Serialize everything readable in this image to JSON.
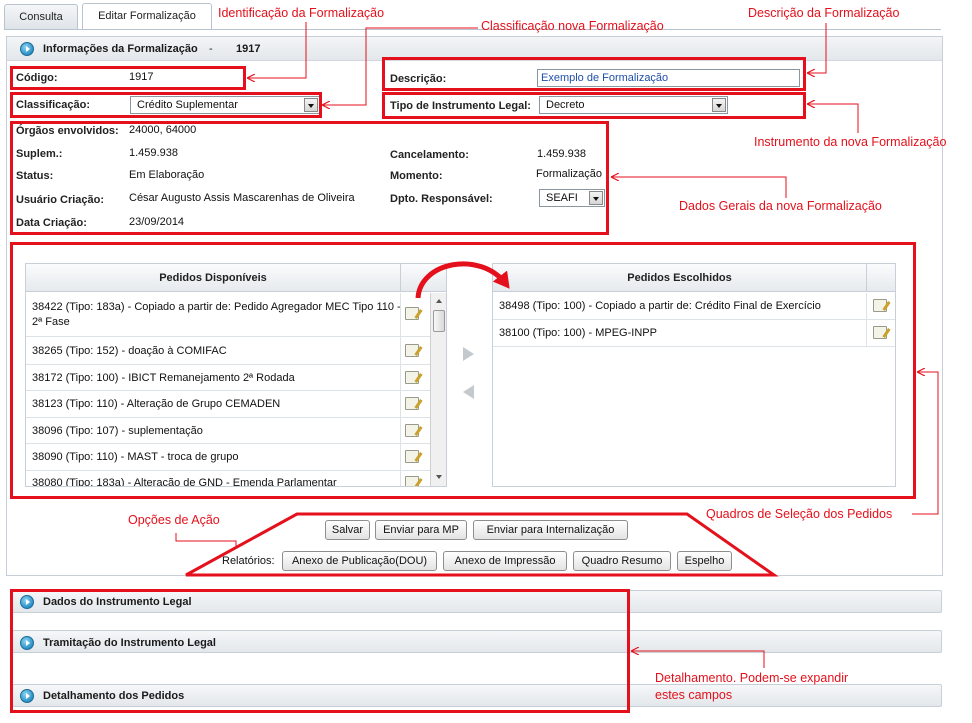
{
  "tabs": [
    {
      "label": "Consulta"
    },
    {
      "label": "Editar Formalização"
    }
  ],
  "header": {
    "title": "Informações da Formalização",
    "separator": "-",
    "id": "1917"
  },
  "form": {
    "codigo_label": "Código:",
    "codigo_value": "1917",
    "descricao_label": "Descrição:",
    "descricao_value": "Exemplo de Formalização",
    "classificacao_label": "Classificação:",
    "classificacao_value": "Crédito Suplementar",
    "tipo_label": "Tipo de Instrumento Legal:",
    "tipo_value": "Decreto",
    "orgaos_label": "Órgãos envolvidos:",
    "orgaos_value": "24000, 64000",
    "suplem_label": "Suplem.:",
    "suplem_value": "1.459.938",
    "cancelamento_label": "Cancelamento:",
    "cancelamento_value": "1.459.938",
    "status_label": "Status:",
    "status_value": "Em Elaboração",
    "momento_label": "Momento:",
    "momento_value": "Formalização",
    "usuario_label": "Usuário Criação:",
    "usuario_value": "César Augusto Assis Mascarenhas de Oliveira",
    "dpto_label": "Dpto. Responsável:",
    "dpto_value": "SEAFI",
    "data_label": "Data Criação:",
    "data_value": "23/09/2014"
  },
  "pedidos_disponiveis": {
    "header": "Pedidos Disponíveis",
    "items": [
      "38422 (Tipo: 183a) - Copiado a partir de: Pedido Agregador MEC Tipo 110 -",
      "2ª Fase",
      "38265 (Tipo: 152) - doação à COMIFAC",
      "38172 (Tipo: 100) - IBICT Remanejamento 2ª Rodada",
      "38123 (Tipo: 110) - Alteração de Grupo CEMADEN",
      "38096 (Tipo: 107) - suplementação",
      "38090 (Tipo: 110) - MAST - troca de grupo",
      "38080 (Tipo: 183a) - Alteração de GND - Emenda Parlamentar"
    ]
  },
  "pedidos_escolhidos": {
    "header": "Pedidos Escolhidos",
    "items": [
      "38498 (Tipo: 100) - Copiado a partir de: Crédito Final de Exercício",
      "38100 (Tipo: 100) - MPEG-INPP"
    ]
  },
  "actions": {
    "salvar": "Salvar",
    "enviar_mp": "Enviar para MP",
    "enviar_internalizacao": "Enviar para Internalização",
    "relatorios_label": "Relatórios:",
    "anexo_publicacao": "Anexo de Publicação(DOU)",
    "anexo_impressao": "Anexo de Impressão",
    "quadro_resumo": "Quadro Resumo",
    "espelho": "Espelho"
  },
  "sections": [
    {
      "title": "Dados do Instrumento Legal"
    },
    {
      "title": "Tramitação do Instrumento Legal"
    },
    {
      "title": "Detalhamento dos Pedidos"
    }
  ],
  "annotations": {
    "identificacao": "Identificação da Formalização",
    "classificacao": "Classificação nova Formalização",
    "descricao": "Descrição da Formalização",
    "instrumento": "Instrumento da nova Formalização",
    "dados_gerais": "Dados Gerais da nova Formalização",
    "opcoes": "Opções de Ação",
    "quadros": "Quadros de Seleção dos Pedidos",
    "detalhamento_1": "Detalhamento. Podem-se expandir",
    "detalhamento_2": "estes campos"
  },
  "colors": {
    "annotation": "#e4101b",
    "link_text": "#1f4fa8",
    "header_icon": "#2a8fc4"
  }
}
